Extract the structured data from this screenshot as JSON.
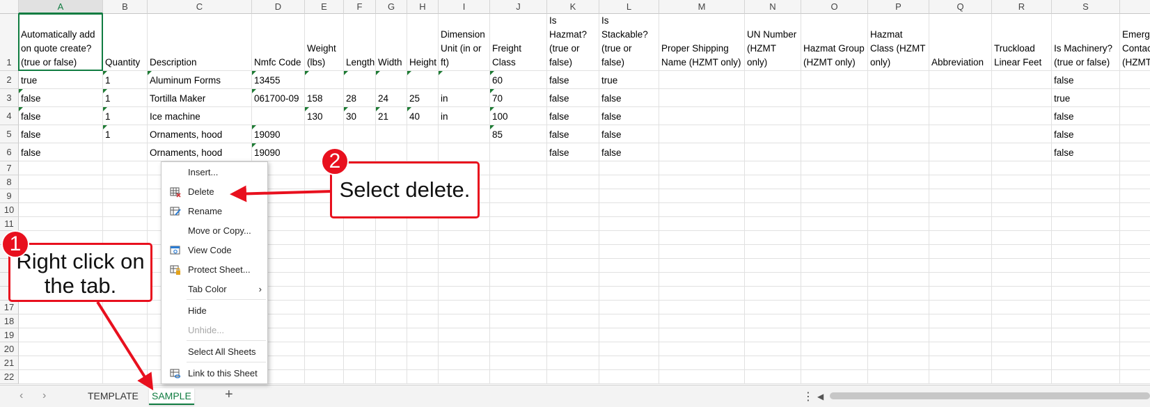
{
  "columns": [
    "A",
    "B",
    "C",
    "D",
    "E",
    "F",
    "G",
    "H",
    "I",
    "J",
    "K",
    "L",
    "M",
    "N",
    "O",
    "P",
    "Q",
    "R",
    "S",
    ""
  ],
  "rows": [
    "1",
    "2",
    "3",
    "4",
    "5",
    "6",
    "7",
    "8",
    "9",
    "10",
    "11",
    "",
    "",
    "",
    "",
    "",
    "17",
    "18",
    "19",
    "20",
    "21",
    "22"
  ],
  "headers": [
    "Automatically add on quote create? (true or false)",
    "Quantity",
    "Description",
    "Nmfc Code",
    "Weight (lbs)",
    "Length",
    "Width",
    "Height",
    "Dimension Unit (in or ft)",
    "Freight Class",
    "Is Hazmat? (true or false)",
    "Is Stackable? (true or false)",
    "Proper Shipping Name (HZMT only)",
    "UN Number (HZMT only)",
    "Hazmat Group (HZMT only)",
    "Hazmat Class (HZMT only)",
    "Abbreviation",
    "Truckload Linear Feet",
    "Is Machinery? (true or false)",
    "Emerg Contac (HZMT"
  ],
  "data_rows": [
    [
      "true",
      "1",
      "Aluminum Forms",
      "13455",
      "",
      "",
      "",
      "",
      "",
      "60",
      "false",
      "true",
      "",
      "",
      "",
      "",
      "",
      "",
      "false",
      ""
    ],
    [
      "false",
      "1",
      "Tortilla Maker",
      "061700-09",
      "158",
      "28",
      "24",
      "25",
      "in",
      "70",
      "false",
      "false",
      "",
      "",
      "",
      "",
      "",
      "",
      "true",
      ""
    ],
    [
      "false",
      "1",
      "Ice machine",
      "",
      "130",
      "30",
      "21",
      "40",
      "in",
      "100",
      "false",
      "false",
      "",
      "",
      "",
      "",
      "",
      "",
      "false",
      ""
    ],
    [
      "false",
      "1",
      "Ornaments, hood",
      "19090",
      "",
      "",
      "",
      "",
      "",
      "85",
      "false",
      "false",
      "",
      "",
      "",
      "",
      "",
      "",
      "false",
      ""
    ],
    [
      "false",
      "",
      "Ornaments, hood",
      "19090",
      "",
      "",
      "",
      "",
      "",
      "",
      "false",
      "false",
      "",
      "",
      "",
      "",
      "",
      "",
      "false",
      ""
    ]
  ],
  "context_menu": {
    "items": [
      {
        "label": "Insert...",
        "icon": "",
        "disabled": false
      },
      {
        "label": "Delete",
        "icon": "delete-sheet-icon",
        "disabled": false
      },
      {
        "label": "Rename",
        "icon": "rename-sheet-icon",
        "disabled": false
      },
      {
        "label": "Move or Copy...",
        "icon": "",
        "disabled": false
      },
      {
        "label": "View Code",
        "icon": "view-code-icon",
        "disabled": false
      },
      {
        "label": "Protect Sheet...",
        "icon": "protect-sheet-icon",
        "disabled": false
      },
      {
        "label": "Tab Color",
        "icon": "",
        "disabled": false,
        "submenu": true
      },
      {
        "label": "Hide",
        "icon": "",
        "disabled": false
      },
      {
        "label": "Unhide...",
        "icon": "",
        "disabled": true
      },
      {
        "label": "Select All Sheets",
        "icon": "",
        "disabled": false
      },
      {
        "label": "Link to this Sheet",
        "icon": "link-sheet-icon",
        "disabled": false
      }
    ]
  },
  "tabs": {
    "nav_prev": "‹",
    "nav_next": "›",
    "items": [
      {
        "label": "TEMPLATE",
        "active": false
      },
      {
        "label": "SAMPLE",
        "active": true
      }
    ],
    "add": "+",
    "more": "⋮"
  },
  "callouts": {
    "step1_number": "1",
    "step1_text": "Right click on the tab.",
    "step2_number": "2",
    "step2_text": "Select delete."
  },
  "colors": {
    "accent": "#107c41",
    "callout": "#e8101e"
  }
}
